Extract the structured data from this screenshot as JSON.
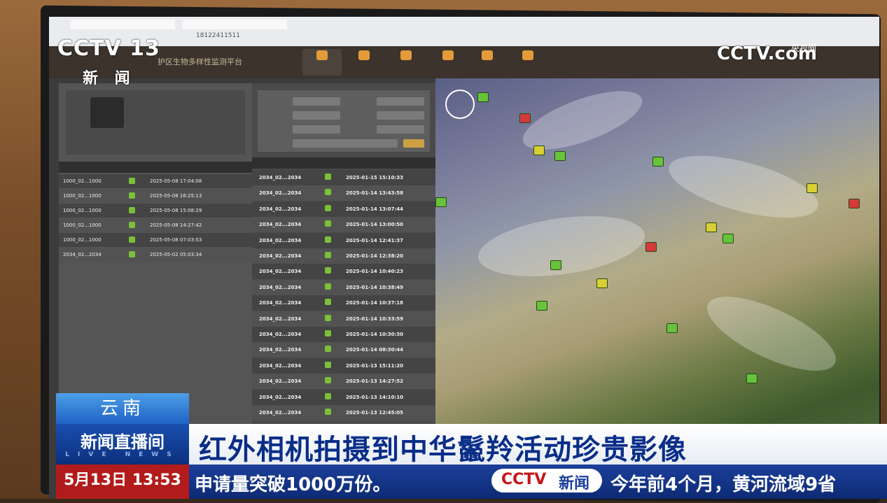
{
  "overlay": {
    "channel_logo": "CCTV 13",
    "channel_name": "新 闻",
    "cctvcom_logo": "CCTV.com",
    "cctvcom_label": "央视网"
  },
  "lower_third": {
    "region": "云南",
    "program": "新闻直播间",
    "program_sub": "LIVE NEWS",
    "headline": "红外相机拍摄到中华鬣羚活动珍贵影像",
    "date": "5月13日",
    "time": "13:53",
    "ticker_left": "申请量突破1000万份。",
    "ticker_logo_cctv": "CCTV",
    "ticker_logo_news": "新闻",
    "ticker_right": "今年前4个月，黄河流域9省"
  },
  "browser": {
    "url": "18122411511"
  },
  "app": {
    "title": "护区生物多样性监测平台",
    "nav": [
      "",
      "",
      "",
      "",
      "",
      ""
    ]
  },
  "left_table": {
    "rows": [
      {
        "id": "1000_02...1000",
        "time": "2025-05-08 17:04:08"
      },
      {
        "id": "1000_02...1000",
        "time": "2025-05-08 16:25:13"
      },
      {
        "id": "1000_02...1000",
        "time": "2025-05-08 15:08:29"
      },
      {
        "id": "1000_02...1000",
        "time": "2025-05-08 14:27:42"
      },
      {
        "id": "1000_02...1000",
        "time": "2025-05-08 07:03:53"
      },
      {
        "id": "2034_02...2034",
        "time": "2025-05-02 05:03:34"
      }
    ]
  },
  "mid_table": {
    "rows": [
      {
        "id": "2034_02...2034",
        "time": "2025-01-15 15:10:33"
      },
      {
        "id": "2034_02...2034",
        "time": "2025-01-14 13:43:58"
      },
      {
        "id": "2034_02...2034",
        "time": "2025-01-14 13:07:44"
      },
      {
        "id": "2034_02...2034",
        "time": "2025-01-14 13:00:50"
      },
      {
        "id": "2034_02...2034",
        "time": "2025-01-14 12:41:37"
      },
      {
        "id": "2034_02...2034",
        "time": "2025-01-14 12:38:20"
      },
      {
        "id": "2034_02...2034",
        "time": "2025-01-14 10:40:23"
      },
      {
        "id": "2034_02...2034",
        "time": "2025-01-14 10:38:49"
      },
      {
        "id": "2034_02...2034",
        "time": "2025-01-14 10:37:18"
      },
      {
        "id": "2034_02...2034",
        "time": "2025-01-14 10:33:59"
      },
      {
        "id": "2034_02...2034",
        "time": "2025-01-14 10:30:30"
      },
      {
        "id": "2034_02...2034",
        "time": "2025-01-14 08:30:44"
      },
      {
        "id": "2034_02...2034",
        "time": "2025-01-13 15:11:20"
      },
      {
        "id": "2034_02...2034",
        "time": "2025-01-13 14:27:52"
      },
      {
        "id": "2034_02...2034",
        "time": "2025-01-13 14:10:10"
      },
      {
        "id": "2034_02...2034",
        "time": "2025-01-13 12:45:05"
      }
    ]
  },
  "colors": {
    "program_blue": "#0c2f7c",
    "headline_blue": "#0a2e88",
    "ticker_red": "#b21b1b",
    "camera_green": "#68c33a",
    "alert_red": "#d43a3a"
  }
}
